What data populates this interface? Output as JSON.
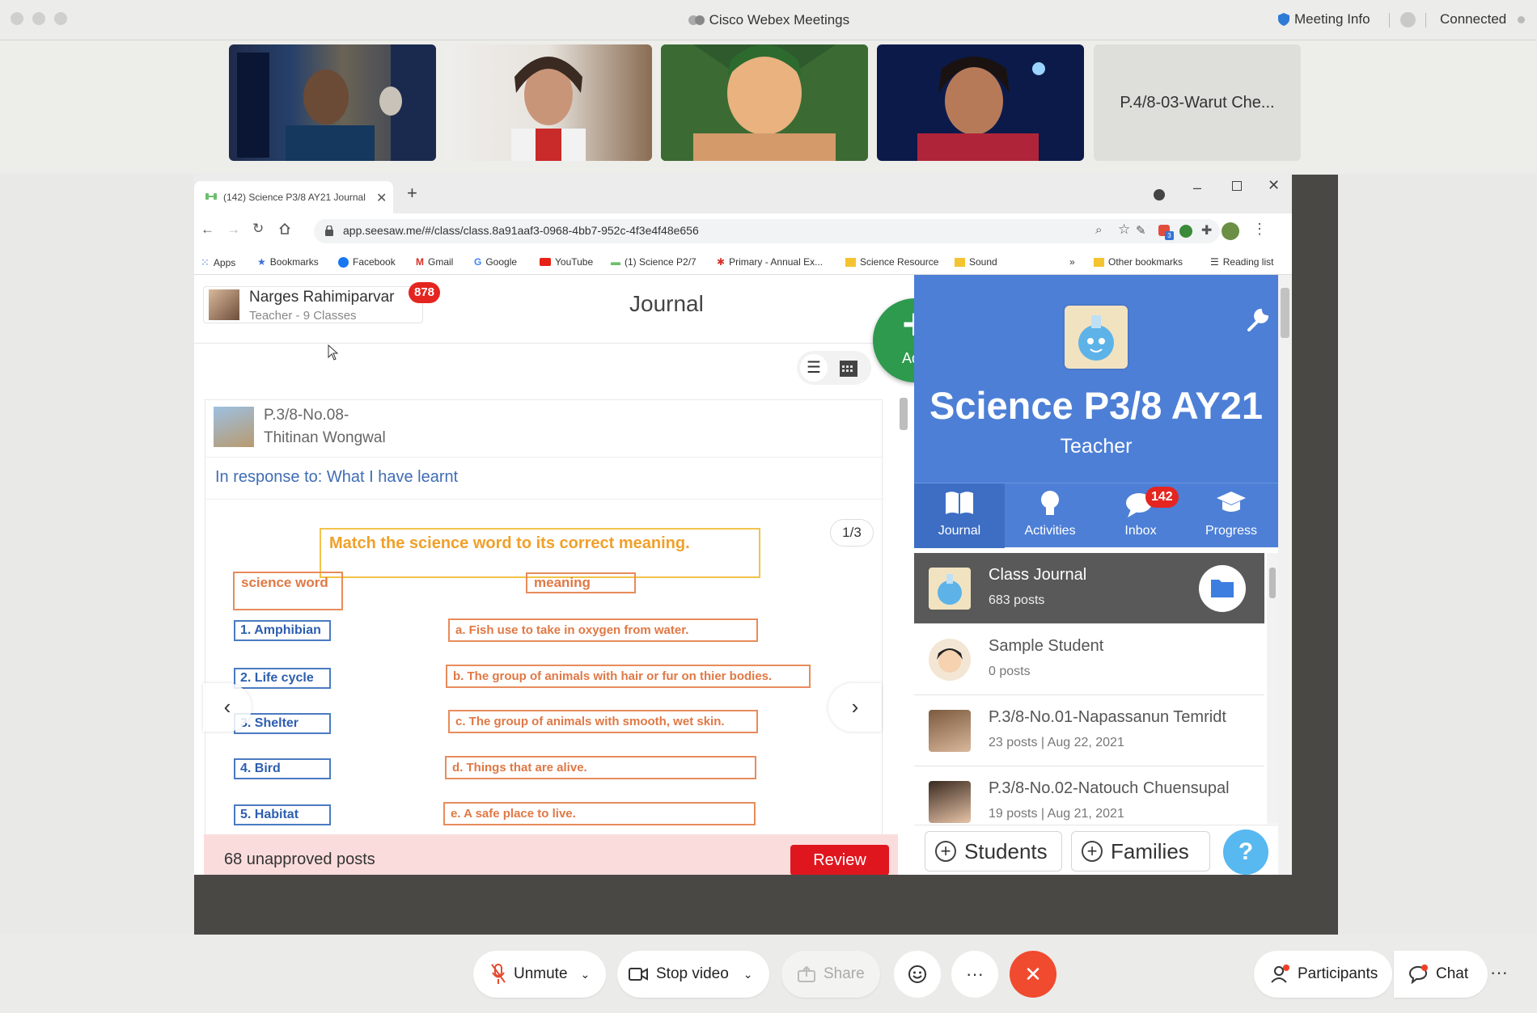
{
  "app": {
    "title": "Cisco Webex Meetings",
    "meeting_info": "Meeting Info",
    "status": "Connected"
  },
  "videos": {
    "tile5_name": "P.4/8-03-Warut Che..."
  },
  "browser": {
    "tab_title": "(142) Science P3/8 AY21 Journal",
    "url": "app.seesaw.me/#/class/class.8a91aaf3-0968-4bb7-952c-4f3e4f48e656",
    "bookmarks": [
      "Apps",
      "Bookmarks",
      "Facebook",
      "Gmail",
      "Google",
      "YouTube",
      "(1) Science P2/7",
      "Primary - Annual Ex...",
      "Science Resource",
      "Sound"
    ],
    "more": "»",
    "other_bookmarks": "Other bookmarks",
    "reading_list": "Reading list",
    "ext_badge": "3"
  },
  "seesaw": {
    "teacher_name": "Narges Rahimiparvar",
    "teacher_sub": "Teacher - 9 Classes",
    "notif_count": "878",
    "page_title": "Journal",
    "add_label": "Add",
    "post": {
      "student_line1": "P.3/8-No.08-",
      "student_line2": "Thitinan Wongwal",
      "response": "In response to: What I have learnt",
      "page_indicator": "1/3"
    },
    "worksheet": {
      "title": "Match the science word to its correct meaning.",
      "col_word": "science word",
      "col_meaning": "meaning",
      "words": [
        "1. Amphibian",
        "2. Life cycle",
        "3. Shelter",
        "4. Bird",
        "5. Habitat"
      ],
      "meanings": [
        "a. Fish use to take in oxygen from water.",
        "b. The group of animals with hair or fur on thier bodies.",
        "c. The group of animals with smooth, wet skin.",
        "d. Things that are alive.",
        "e. A safe place to live."
      ]
    },
    "unapproved": "68 unapproved posts",
    "review": "Review",
    "class_name": "Science P3/8 AY21",
    "role": "Teacher",
    "nav": [
      {
        "label": "Journal"
      },
      {
        "label": "Activities"
      },
      {
        "label": "Inbox",
        "badge": "142"
      },
      {
        "label": "Progress"
      }
    ],
    "list": [
      {
        "name": "Class Journal",
        "sub": "683 posts"
      },
      {
        "name": "Sample Student",
        "sub": "0 posts"
      },
      {
        "name": "P.3/8-No.01-Napassanun Temridt",
        "sub": "23 posts | Aug 22, 2021"
      },
      {
        "name": "P.3/8-No.02-Natouch Chuensupal",
        "sub": "19 posts | Aug 21, 2021"
      }
    ],
    "students_btn": "Students",
    "families_btn": "Families",
    "help": "?"
  },
  "controls": {
    "unmute": "Unmute",
    "stop_video": "Stop video",
    "share": "Share",
    "more": "···",
    "participants": "Participants",
    "chat": "Chat"
  },
  "colors": {
    "seesaw_blue": "#4d7fd6",
    "add_green": "#2e9a4e",
    "badge_red": "#e52520",
    "leave_red": "#f04a2f"
  }
}
